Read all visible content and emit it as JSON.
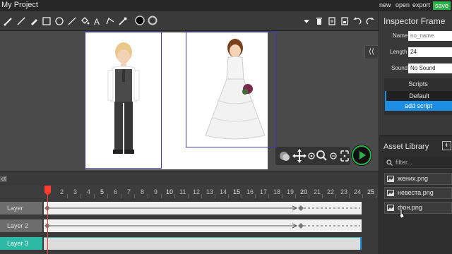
{
  "app": {
    "title": "My Project"
  },
  "menu": {
    "new": "new",
    "open": "open",
    "export": "export",
    "save": "save"
  },
  "toolbar": {
    "tools": [
      "brush-icon",
      "pencil-icon",
      "eraser-icon",
      "rectangle-icon",
      "ellipse-icon",
      "line-icon",
      "fill-bucket-icon",
      "text-icon",
      "path-icon",
      "eyedropper-icon"
    ],
    "stroke_color": "#000000",
    "fill_color": "#ffffff"
  },
  "inspector": {
    "title": "Inspector Frame",
    "name_label": "Name",
    "name_placeholder": "no_name",
    "length_label": "Length",
    "length_value": "24",
    "sound_label": "Sound",
    "sound_value": "No Sound",
    "scripts_title": "Scripts",
    "script_default": "Default",
    "add_script": "add script"
  },
  "assets": {
    "title": "Asset Library",
    "filter_placeholder": "filter...",
    "items": [
      "жених.png",
      "невеста.png",
      "фон.png"
    ]
  },
  "timeline": {
    "tab_label": "ct",
    "ticks": [
      "2",
      "3",
      "4",
      "5",
      "6",
      "7",
      "8",
      "9",
      "10",
      "11",
      "12",
      "13",
      "14",
      "15",
      "16",
      "17",
      "18",
      "19",
      "20",
      "21",
      "22",
      "23",
      "24",
      "25"
    ],
    "major_ticks": [
      "5",
      "10",
      "15",
      "20",
      "25"
    ],
    "layers": [
      "Layer",
      "Layer 2",
      "Layer 3"
    ]
  },
  "colors": {
    "accent": "#1c8fe5",
    "save": "#2db14b",
    "playhead": "#ff3b2f",
    "play": "#2db14b"
  }
}
